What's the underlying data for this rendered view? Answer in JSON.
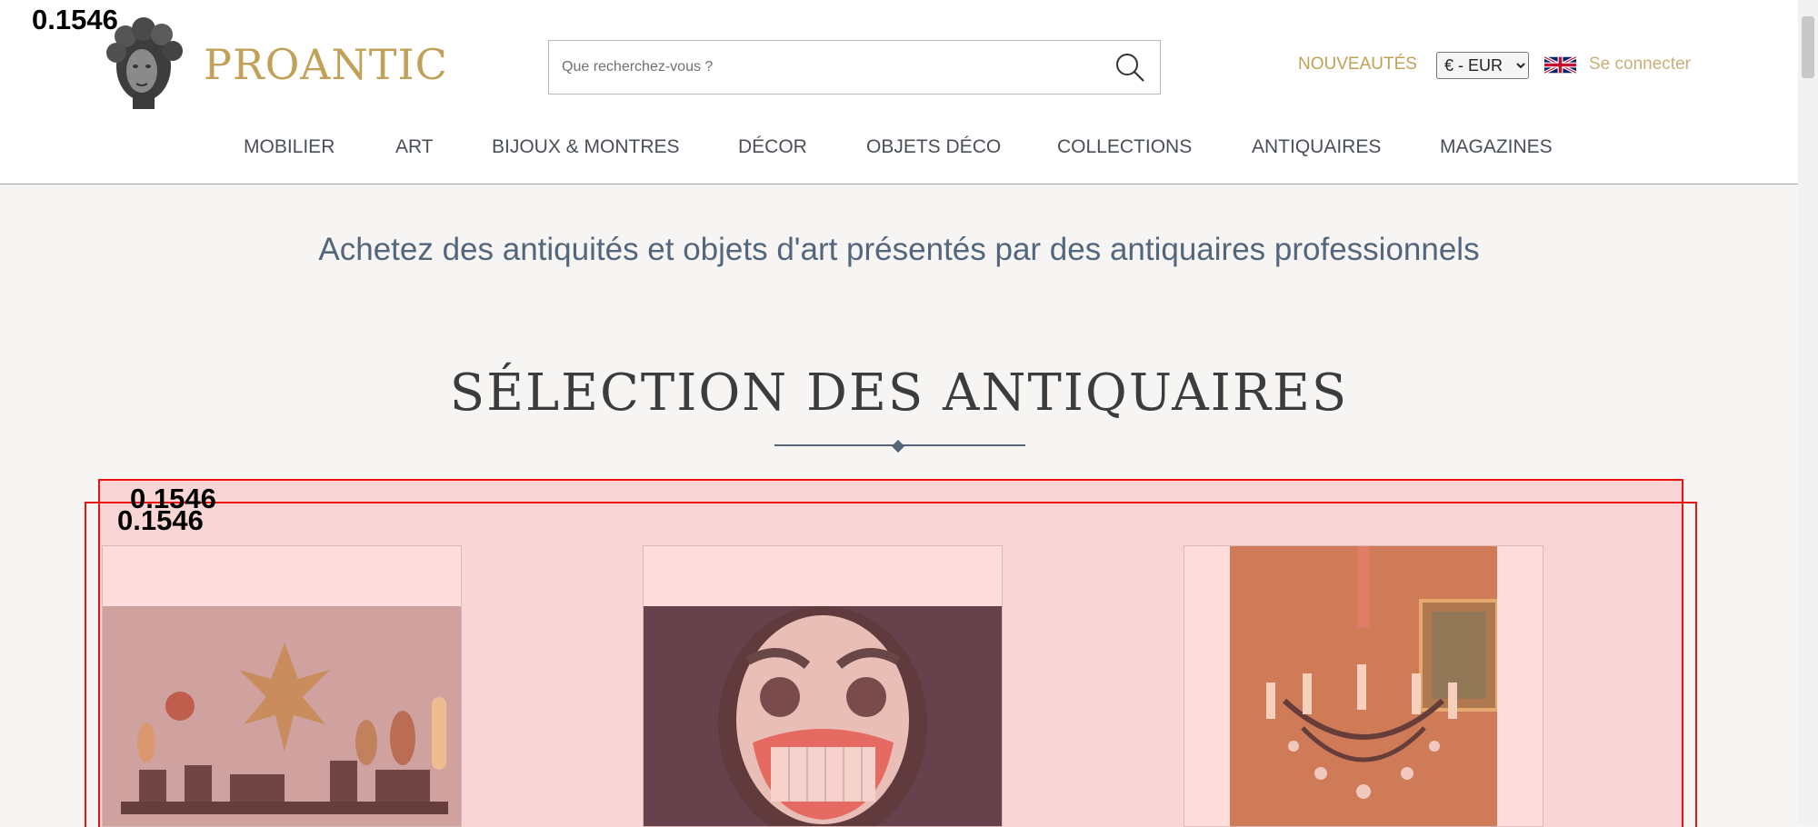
{
  "header": {
    "logo_text": "PROANTIC",
    "search_placeholder": "Que recherchez-vous ?",
    "nouveautes": "NOUVEAUTÉS",
    "currency_selected": "€ - EUR",
    "language_flag": "uk-flag-icon",
    "connect": "Se connecter"
  },
  "nav": {
    "items": [
      "MOBILIER",
      "ART",
      "BIJOUX & MONTRES",
      "DÉCOR",
      "OBJETS DÉCO",
      "COLLECTIONS",
      "ANTIQUAIRES",
      "MAGAZINES"
    ]
  },
  "main": {
    "tagline": "Achetez des antiquités et objets d'art présentés par des antiquaires professionnels",
    "section_title": "SÉLECTION DES ANTIQUAIRES"
  },
  "overlays": {
    "score_top_left": "0.1546",
    "score_box_1": "0.1546",
    "score_box_2": "0.1546"
  },
  "products": [
    {
      "image": "sculptural-objects-on-stands-photo"
    },
    {
      "image": "carved-painted-mask-photo"
    },
    {
      "image": "crystal-chandelier-photo"
    }
  ],
  "colors": {
    "accent_gold": "#c1a057",
    "slate_blue": "#54667c",
    "overlay_red": "#ee1111"
  }
}
